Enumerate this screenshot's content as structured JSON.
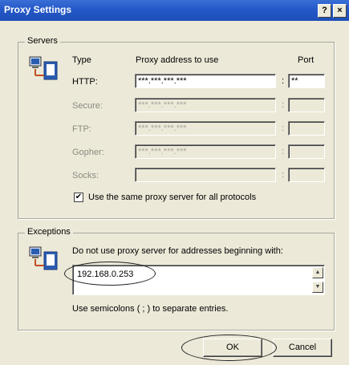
{
  "window": {
    "title": "Proxy Settings",
    "help_label": "?",
    "close_label": "×"
  },
  "servers": {
    "legend": "Servers",
    "col_type": "Type",
    "col_address": "Proxy address to use",
    "col_port": "Port",
    "rows": [
      {
        "label": "HTTP:",
        "address": "***.***.***.***",
        "port": "**",
        "enabled": true
      },
      {
        "label": "Secure:",
        "address": "***.***.***.***",
        "port": "",
        "enabled": false
      },
      {
        "label": "FTP:",
        "address": "***.***.***.***",
        "port": "",
        "enabled": false
      },
      {
        "label": "Gopher:",
        "address": "***.***.***.***",
        "port": "",
        "enabled": false
      },
      {
        "label": "Socks:",
        "address": "",
        "port": "",
        "enabled": false
      }
    ],
    "colon": ":",
    "same_proxy_label": "Use the same proxy server for all protocols",
    "same_proxy_checked": true,
    "check_mark": "✔"
  },
  "exceptions": {
    "legend": "Exceptions",
    "description": "Do not use proxy server for addresses beginning with:",
    "value": "192.168.0.253",
    "hint": "Use semicolons ( ; ) to separate entries.",
    "scroll_up": "▲",
    "scroll_down": "▼"
  },
  "buttons": {
    "ok": "OK",
    "cancel": "Cancel"
  },
  "colors": {
    "titlebar": "#2458c8",
    "dialog_bg": "#ece9d8"
  }
}
